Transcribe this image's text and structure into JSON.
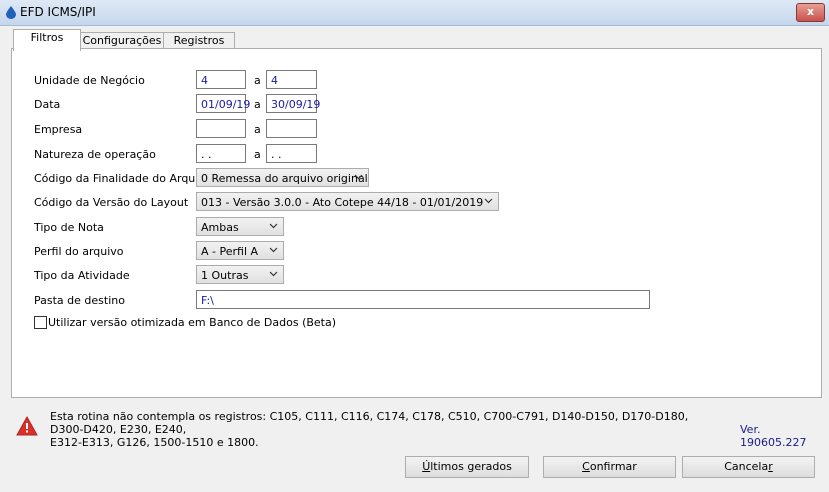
{
  "window": {
    "title": "EFD ICMS/IPI",
    "close_label": "x"
  },
  "tabs": [
    {
      "label": "Filtros",
      "active": true
    },
    {
      "label": "Configurações",
      "active": false
    },
    {
      "label": "Registros",
      "active": false
    }
  ],
  "form": {
    "unidade": {
      "label": "Unidade de Negócio",
      "from": "4",
      "sep": "a",
      "to": "4"
    },
    "data": {
      "label": "Data",
      "from": "01/09/19",
      "sep": "a",
      "to": "30/09/19"
    },
    "empresa": {
      "label": "Empresa",
      "from": "",
      "sep": "a",
      "to": ""
    },
    "natureza": {
      "label": "Natureza de operação",
      "from": ". .",
      "sep": "a",
      "to": ". ."
    },
    "finalidade": {
      "label": "Código da Finalidade do Arquivo",
      "value": "0 Remessa do arquivo original"
    },
    "versao": {
      "label": "Código da Versão do Layout",
      "value": "013 - Versão 3.0.0 - Ato Cotepe 44/18 - 01/01/2019"
    },
    "tipo_nota": {
      "label": "Tipo de Nota",
      "value": "Ambas"
    },
    "perfil": {
      "label": "Perfil do arquivo",
      "value": "A - Perfil A"
    },
    "atividade": {
      "label": "Tipo da Atividade",
      "value": "1 Outras"
    },
    "pasta": {
      "label": "Pasta de destino",
      "value": "F:\\"
    },
    "otimizada": {
      "label": "Utilizar versão otimizada em Banco de Dados (Beta)",
      "checked": false
    }
  },
  "footer": {
    "warning_line1": "Esta rotina não contempla os registros: C105, C111, C116, C174, C178, C510, C700-C791, D140-D150, D170-D180, D300-D420, E230, E240,",
    "warning_line2": "E312-E313, G126, 1500-1510 e 1800.",
    "version": "Ver. 190605.227",
    "warning_icon": "warning-triangle-icon",
    "accent_color": "#d9302b"
  },
  "buttons": {
    "ultimos_prefix": "Ú",
    "ultimos_rest": "ltimos gerados",
    "confirmar_prefix": "C",
    "confirmar_rest": "onfirmar",
    "cancelar_main": "Cancela",
    "cancelar_suffix": "r"
  }
}
